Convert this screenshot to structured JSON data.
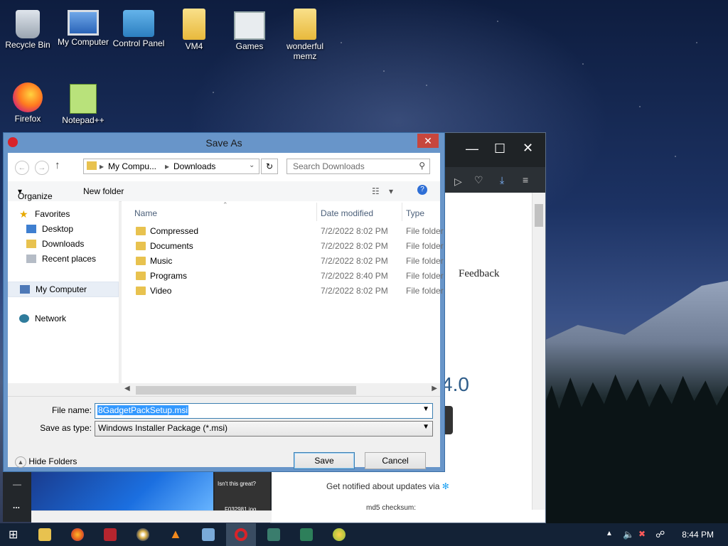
{
  "desktop": {
    "icons": [
      {
        "label": "Recycle Bin",
        "icon": "recycle-bin-icon"
      },
      {
        "label": "My Computer",
        "icon": "computer-icon"
      },
      {
        "label": "Control Panel",
        "icon": "control-panel-icon"
      },
      {
        "label": "VM4",
        "icon": "folder-user-icon"
      },
      {
        "label": "Games",
        "icon": "games-icon"
      },
      {
        "label": "wonderful memz",
        "icon": "folder-icon"
      },
      {
        "label": "Firefox",
        "icon": "firefox-icon"
      },
      {
        "label": "Notepad++",
        "icon": "notepad-plus-plus-icon"
      }
    ]
  },
  "browser": {
    "feedback": "Feedback",
    "version_fragment": "4.0",
    "notify_text": "Get notified about updates via",
    "md5_label": "md5 checksum:",
    "thumb_text_1": "Isn't this great?",
    "thumb_text_2": "F032981.jpg",
    "ellipsis": "..."
  },
  "dialog": {
    "title": "Save As",
    "breadcrumb": [
      "My Compu...",
      "Downloads"
    ],
    "search_placeholder": "Search Downloads",
    "organize": "Organize",
    "new_folder": "New folder",
    "nav": {
      "favorites": "Favorites",
      "desktop": "Desktop",
      "downloads": "Downloads",
      "recent": "Recent places",
      "computer": "My Computer",
      "network": "Network"
    },
    "columns": {
      "name": "Name",
      "date": "Date modified",
      "type": "Type"
    },
    "files": [
      {
        "name": "Compressed",
        "date": "7/2/2022 8:02 PM",
        "type": "File folder"
      },
      {
        "name": "Documents",
        "date": "7/2/2022 8:02 PM",
        "type": "File folder"
      },
      {
        "name": "Music",
        "date": "7/2/2022 8:02 PM",
        "type": "File folder"
      },
      {
        "name": "Programs",
        "date": "7/2/2022 8:40 PM",
        "type": "File folder"
      },
      {
        "name": "Video",
        "date": "7/2/2022 8:02 PM",
        "type": "File folder"
      }
    ],
    "file_name_label": "File name:",
    "file_name_value": "8GadgetPackSetup.msi",
    "save_type_label": "Save as type:",
    "save_type_value": "Windows Installer Package (*.msi)",
    "hide_folders": "Hide Folders",
    "save": "Save",
    "cancel": "Cancel"
  },
  "taskbar": {
    "clock": "8:44 PM"
  }
}
